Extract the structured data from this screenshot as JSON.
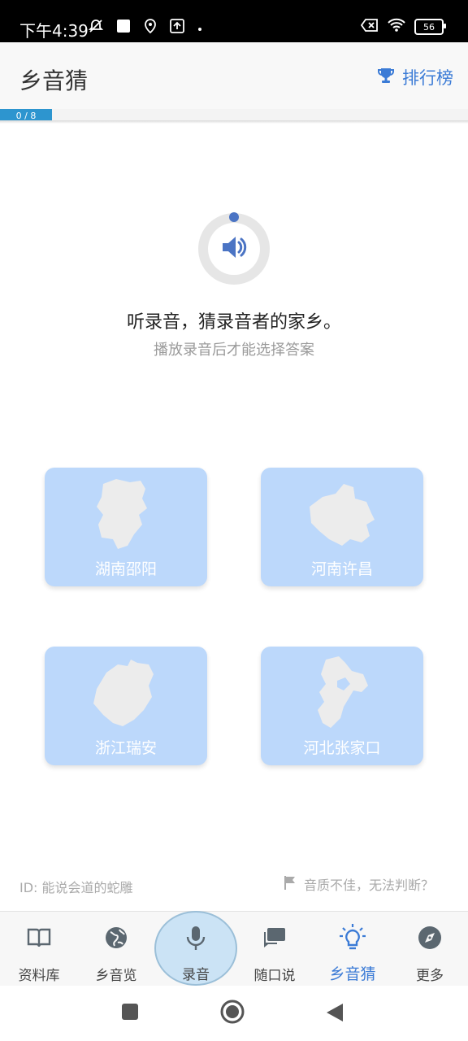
{
  "status_bar": {
    "time": "下午4:39",
    "battery": "56",
    "left_icons": [
      "mute-icon",
      "square-icon",
      "location-icon",
      "upload-icon",
      "dot-icon"
    ],
    "right_icons": [
      "x-box-icon",
      "wifi-icon",
      "battery-icon"
    ]
  },
  "header": {
    "title": "乡音猜",
    "leaderboard_label": "排行榜",
    "progress_text": "0 / 8",
    "progress_value": 0,
    "progress_total": 8
  },
  "player": {
    "prompt": "听录音，猜录音者的家乡。",
    "hint": "播放录音后才能选择答案",
    "icon": "speaker-icon"
  },
  "options": [
    {
      "label": "湖南邵阳"
    },
    {
      "label": "河南许昌"
    },
    {
      "label": "浙江瑞安"
    },
    {
      "label": "河北张家口"
    }
  ],
  "footer": {
    "id_text": "ID: 能说会道的蛇雕",
    "report_text": "音质不佳，无法判断？"
  },
  "tabs": [
    {
      "label": "资料库",
      "icon": "book-icon"
    },
    {
      "label": "乡音览",
      "icon": "globe-icon"
    },
    {
      "label": "录音",
      "icon": "mic-icon"
    },
    {
      "label": "随口说",
      "icon": "chat-icon"
    },
    {
      "label": "乡音猜",
      "icon": "lightbulb-icon",
      "active": true
    },
    {
      "label": "更多",
      "icon": "compass-icon"
    }
  ],
  "colors": {
    "accent": "#3b7bd6",
    "option_bg": "#bcd8fb",
    "progress": "#2d95cf"
  }
}
